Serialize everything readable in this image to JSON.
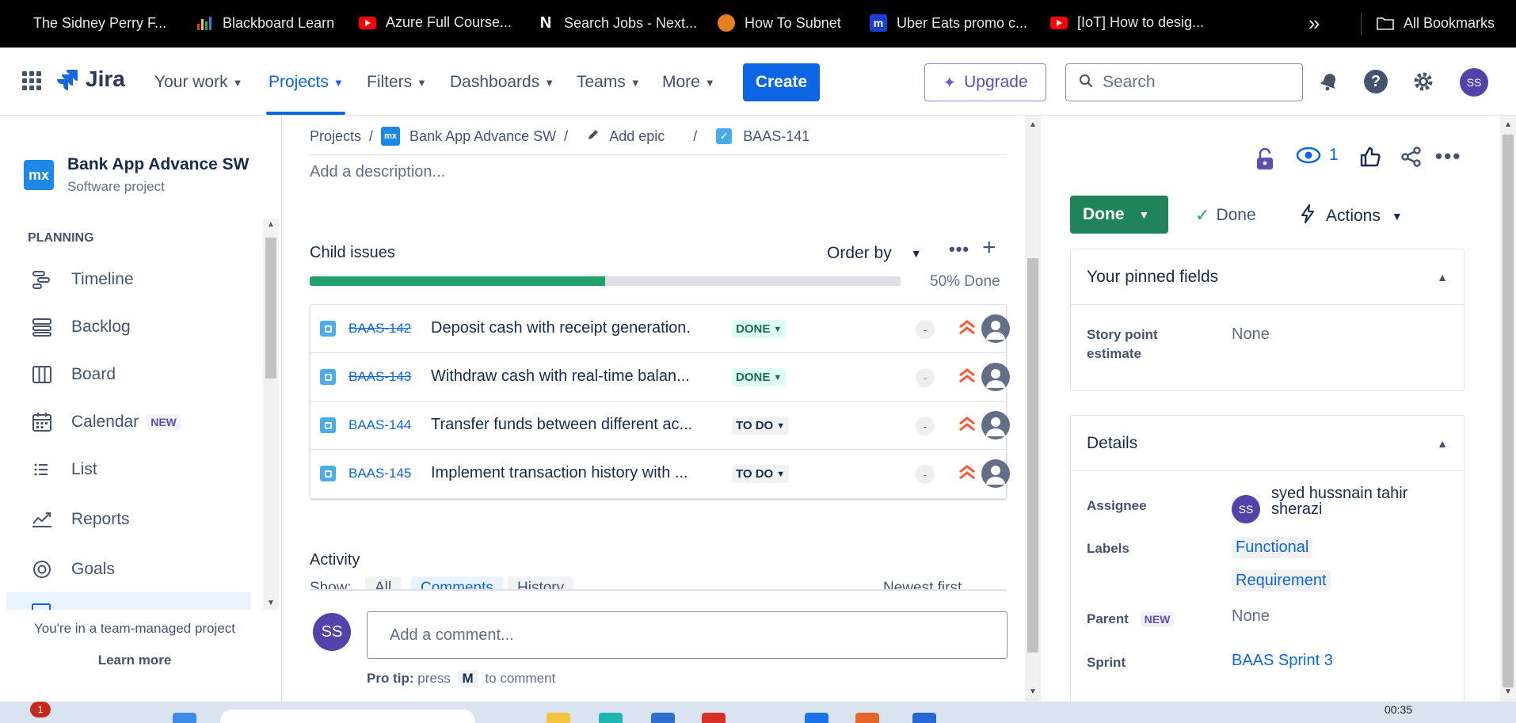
{
  "bookmarks": {
    "items": [
      {
        "label": "The Sidney Perry F...",
        "icon": "sidney-perry-icon"
      },
      {
        "label": "Blackboard Learn",
        "icon": "blackboard-icon"
      },
      {
        "label": "Azure Full Course...",
        "icon": "youtube-icon"
      },
      {
        "label": "Search Jobs - Next...",
        "icon": "notion-icon"
      },
      {
        "label": "How To Subnet",
        "icon": "basketball-icon"
      },
      {
        "label": "Uber Eats promo c...",
        "icon": "uber-icon"
      },
      {
        "label": "[IoT] How to desig...",
        "icon": "youtube-icon"
      }
    ],
    "overflow": "»",
    "all_bookmarks": "All Bookmarks"
  },
  "topnav": {
    "app_name": "Jira",
    "items": [
      {
        "label": "Your work"
      },
      {
        "label": "Projects"
      },
      {
        "label": "Filters"
      },
      {
        "label": "Dashboards"
      },
      {
        "label": "Teams"
      },
      {
        "label": "More"
      }
    ],
    "active": "Projects",
    "create_label": "Create",
    "upgrade_label": "Upgrade",
    "search_placeholder": "Search",
    "user_initials": "SS"
  },
  "sidebar": {
    "project_logo": "mx",
    "project_name": "Bank App Advance SW",
    "project_type": "Software project",
    "section_title": "PLANNING",
    "items": [
      {
        "label": "Timeline",
        "icon": "timeline-icon"
      },
      {
        "label": "Backlog",
        "icon": "backlog-icon"
      },
      {
        "label": "Board",
        "icon": "board-icon"
      },
      {
        "label": "Calendar",
        "icon": "calendar-icon",
        "badge": "NEW"
      },
      {
        "label": "List",
        "icon": "list-icon"
      },
      {
        "label": "Reports",
        "icon": "reports-icon"
      },
      {
        "label": "Goals",
        "icon": "goals-icon"
      }
    ],
    "footer_text": "You're in a team-managed project",
    "learn_more": "Learn more"
  },
  "main": {
    "breadcrumb": {
      "projects": "Projects",
      "project": "Bank App Advance SW",
      "add_epic": "Add epic",
      "issue_key": "BAAS-141",
      "sep": "/"
    },
    "description_placeholder": "Add a description...",
    "child_issues": {
      "title": "Child issues",
      "order_by": "Order by",
      "progress_percent": 50,
      "progress_label": "50% Done",
      "rows": [
        {
          "key": "BAAS-142",
          "summary": "Deposit cash with receipt generation.",
          "status": "DONE",
          "done": true,
          "estimate": "-"
        },
        {
          "key": "BAAS-143",
          "summary": "Withdraw cash with real-time balan...",
          "status": "DONE",
          "done": true,
          "estimate": "-"
        },
        {
          "key": "BAAS-144",
          "summary": "Transfer funds between different ac...",
          "status": "TO DO",
          "done": false,
          "estimate": "-"
        },
        {
          "key": "BAAS-145",
          "summary": "Implement transaction history with ...",
          "status": "TO DO",
          "done": false,
          "estimate": "-"
        }
      ]
    },
    "activity": {
      "title": "Activity",
      "show_label": "Show:",
      "all": "All",
      "comments": "Comments",
      "history": "History",
      "sort": "Newest first"
    },
    "comment": {
      "avatar": "SS",
      "placeholder": "Add a comment...",
      "pro_tip_label": "Pro tip:",
      "pro_tip_press": "press",
      "pro_tip_key": "M",
      "pro_tip_suffix": "to comment"
    }
  },
  "right": {
    "watch_count": "1",
    "status_label": "Done",
    "resolution_label": "Done",
    "actions_label": "Actions",
    "pinned": {
      "title": "Your pinned fields",
      "story_point_label": "Story point estimate",
      "story_point_value": "None"
    },
    "details": {
      "title": "Details",
      "assignee_label": "Assignee",
      "assignee_initials": "SS",
      "assignee_name": "syed hussnain tahir sherazi",
      "labels_label": "Labels",
      "labels": [
        "Functional",
        "Requirement"
      ],
      "parent_label": "Parent",
      "parent_badge": "NEW",
      "parent_value": "None",
      "sprint_label": "Sprint",
      "sprint_value": "BAAS Sprint 3"
    }
  },
  "taskbar": {
    "badge": "1",
    "time": "00:35"
  },
  "colors": {
    "brand_blue": "#0C66E4",
    "done_green": "#1F845A",
    "progress_green": "#22A06B",
    "priority_orange": "#FF5630",
    "avatar_purple": "#5243AA"
  }
}
